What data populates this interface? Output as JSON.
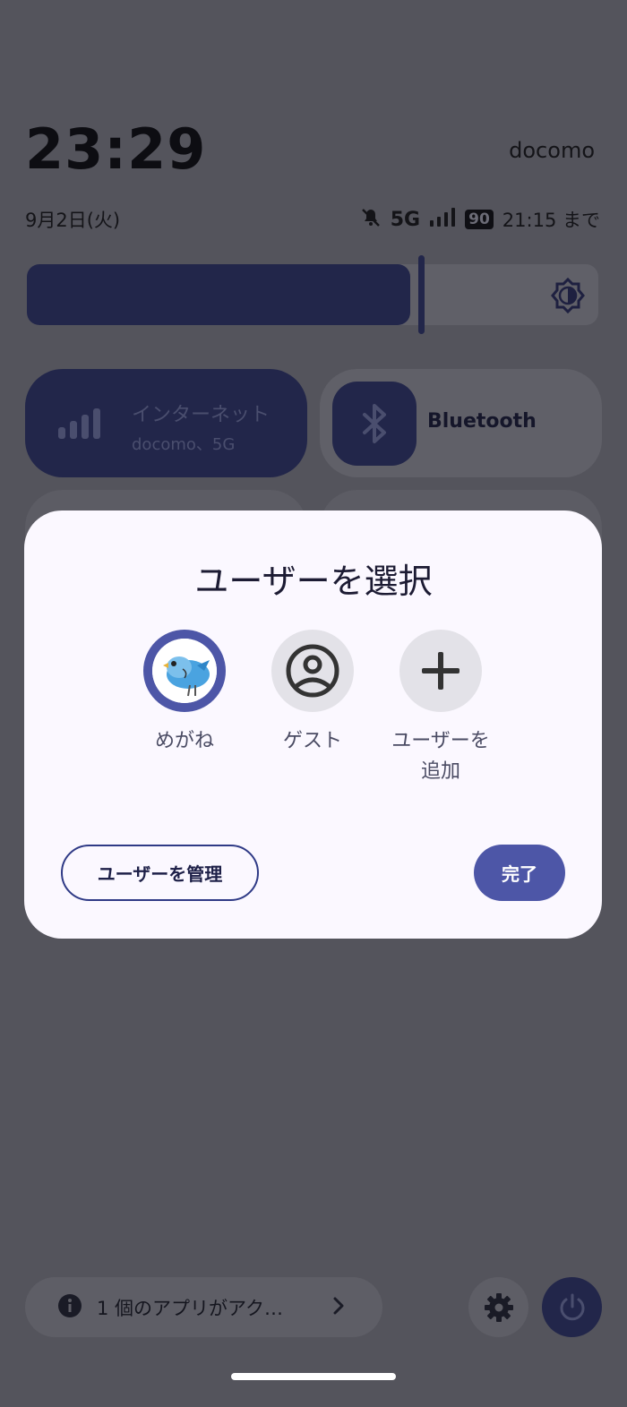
{
  "status": {
    "time": "23:29",
    "carrier": "docomo",
    "date": "9月2日(火)",
    "network_type": "5G",
    "battery": "90",
    "alarm": "21:15 まで"
  },
  "brightness": {
    "level": 0.67
  },
  "tiles": {
    "internet": {
      "title": "インターネット",
      "subtitle": "docomo、5G"
    },
    "bluetooth": {
      "label": "Bluetooth"
    }
  },
  "dialog": {
    "title": "ユーザーを選択",
    "users": [
      {
        "label": "めがね",
        "selected": true
      },
      {
        "label": "ゲスト",
        "selected": false
      },
      {
        "label_line1": "ユーザーを",
        "label_line2": "追加"
      }
    ],
    "manage_button": "ユーザーを管理",
    "done_button": "完了"
  },
  "bottom": {
    "apps_active": "1 個のアプリがアク…"
  },
  "colors": {
    "scrim": "#54545c",
    "accent": "#4d56a7",
    "tile_active": "#22264a",
    "dialog_bg": "#fbf8ff"
  }
}
